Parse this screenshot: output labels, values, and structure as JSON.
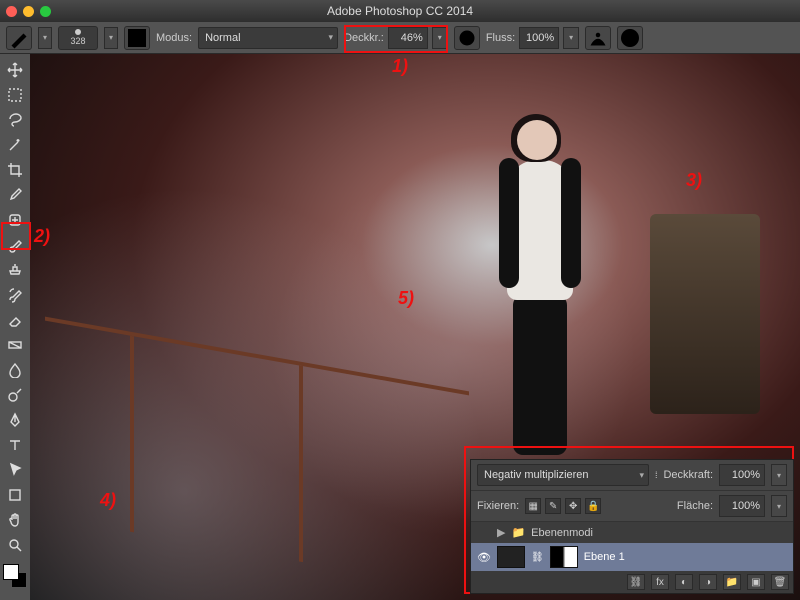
{
  "titlebar": {
    "title": "Adobe Photoshop CC 2014"
  },
  "optbar": {
    "brush_size": "328",
    "modus_label": "Modus:",
    "modus_value": "Normal",
    "deckkr_label": "Deckkr.:",
    "deckkr_value": "46%",
    "fluss_label": "Fluss:",
    "fluss_value": "100%"
  },
  "tools": [
    "move",
    "marquee",
    "lasso",
    "wand",
    "crop",
    "eyedropper",
    "heal",
    "brush",
    "stamp",
    "history-brush",
    "eraser",
    "gradient",
    "blur",
    "dodge",
    "pen",
    "type",
    "path",
    "shape",
    "hand",
    "zoom"
  ],
  "layers": {
    "blend_value": "Negativ multiplizieren",
    "opacity_label": "Deckkraft:",
    "opacity_value": "100%",
    "fix_label": "Fixieren:",
    "fill_label": "Fläche:",
    "fill_value": "100%",
    "group_name": "Ebenenmodi",
    "layer_name": "Ebene 1"
  },
  "annotations": {
    "a1": "1)",
    "a2": "2)",
    "a3": "3)",
    "a4": "4)",
    "a5": "5)"
  }
}
